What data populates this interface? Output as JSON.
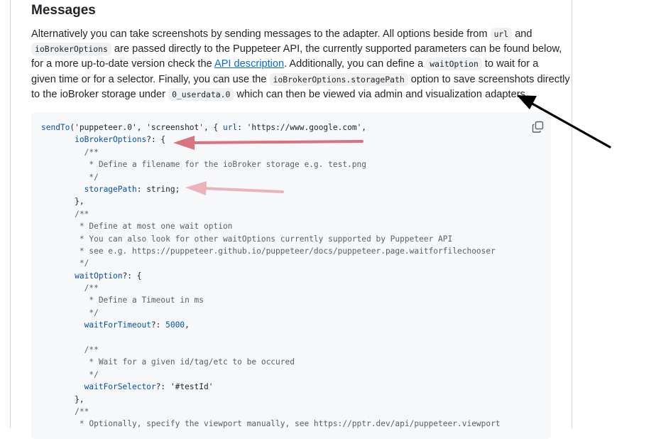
{
  "heading": "Messages",
  "paragraph": {
    "line1": {
      "t1": "Alternatively you can take screenshots by sending messages to the adapter. All options beside from ",
      "c1": "url",
      "t2": " and"
    },
    "line2": {
      "c1": "ioBrokerOptions",
      "t1": " are passed directly to the Puppeteer API, the currently supported parameters can be found below,"
    },
    "line3": {
      "t1": "for a more up-to-date version check the ",
      "link": "API description",
      "t2": ". Additionally, you can define a ",
      "c1": "waitOption",
      "t3": " to wait for a"
    },
    "line4": {
      "t1": "given time or for a selector. Finally, you can use the ",
      "c1": "ioBrokerOptions.storagePath",
      "t2": " option to save screenshots directly"
    },
    "line5": {
      "t1": "to the ioBroker storage under ",
      "c1": "0_userdata.0",
      "t2": " which can then be viewed via admin and visualization adapters."
    }
  },
  "code_lines": [
    [
      {
        "t": "sendTo",
        "c": "#0550ae"
      },
      {
        "t": "('puppeteer.0', 'screenshot', { ",
        "c": "#1f2328"
      },
      {
        "t": "url",
        "c": "#0550ae"
      },
      {
        "t": ": 'https://www.google.com',",
        "c": "#1f2328"
      }
    ],
    [
      {
        "t": "       ",
        "c": "#1f2328"
      },
      {
        "t": "ioBrokerOptions",
        "c": "#0550ae"
      },
      {
        "t": "?: {",
        "c": "#1f2328"
      }
    ],
    [
      {
        "t": "         /**",
        "c": "#57606a"
      }
    ],
    [
      {
        "t": "          * Define a filename for the ioBroker storage e.g. test.png",
        "c": "#57606a"
      }
    ],
    [
      {
        "t": "          */",
        "c": "#57606a"
      }
    ],
    [
      {
        "t": "         ",
        "c": "#1f2328"
      },
      {
        "t": "storagePath",
        "c": "#0550ae"
      },
      {
        "t": ": string;",
        "c": "#1f2328"
      }
    ],
    [
      {
        "t": "       },",
        "c": "#1f2328"
      }
    ],
    [
      {
        "t": "       /**",
        "c": "#57606a"
      }
    ],
    [
      {
        "t": "        * Define at most one wait option",
        "c": "#57606a"
      }
    ],
    [
      {
        "t": "        * You can also look for other waitOptions currently supported by Puppeteer API",
        "c": "#57606a"
      }
    ],
    [
      {
        "t": "        * see e.g. https://puppeteer.github.io/puppeteer/docs/puppeteer.page.waitforfilechooser",
        "c": "#57606a"
      }
    ],
    [
      {
        "t": "        */",
        "c": "#57606a"
      }
    ],
    [
      {
        "t": "       ",
        "c": "#1f2328"
      },
      {
        "t": "waitOption",
        "c": "#0550ae"
      },
      {
        "t": "?: {",
        "c": "#1f2328"
      }
    ],
    [
      {
        "t": "         /**",
        "c": "#57606a"
      }
    ],
    [
      {
        "t": "          * Define a Timeout in ms",
        "c": "#57606a"
      }
    ],
    [
      {
        "t": "          */",
        "c": "#57606a"
      }
    ],
    [
      {
        "t": "         ",
        "c": "#1f2328"
      },
      {
        "t": "waitForTimeout",
        "c": "#0550ae"
      },
      {
        "t": "?: ",
        "c": "#1f2328"
      },
      {
        "t": "5000",
        "c": "#0550ae"
      },
      {
        "t": ",",
        "c": "#1f2328"
      }
    ],
    [
      {
        "t": "",
        "c": "#1f2328"
      }
    ],
    [
      {
        "t": "         /**",
        "c": "#57606a"
      }
    ],
    [
      {
        "t": "          * Wait for a given id/tag/etc to be occured",
        "c": "#57606a"
      }
    ],
    [
      {
        "t": "          */",
        "c": "#57606a"
      }
    ],
    [
      {
        "t": "         ",
        "c": "#1f2328"
      },
      {
        "t": "waitForSelector",
        "c": "#0550ae"
      },
      {
        "t": "?: '#testId'",
        "c": "#1f2328"
      }
    ],
    [
      {
        "t": "       },",
        "c": "#1f2328"
      }
    ],
    [
      {
        "t": "       /**",
        "c": "#57606a"
      }
    ],
    [
      {
        "t": "        * Optionally, specify the viewport manually, see https://pptr.dev/api/puppeteer.viewport",
        "c": "#57606a"
      }
    ]
  ],
  "icons": {
    "copy": "copy-icon"
  },
  "colors": {
    "arrow_black": "#000000",
    "arrow_red": "#d9737f",
    "arrow_pink": "#ebb4bc",
    "link": "#0969da",
    "code_bg": "#f6f8fa"
  }
}
